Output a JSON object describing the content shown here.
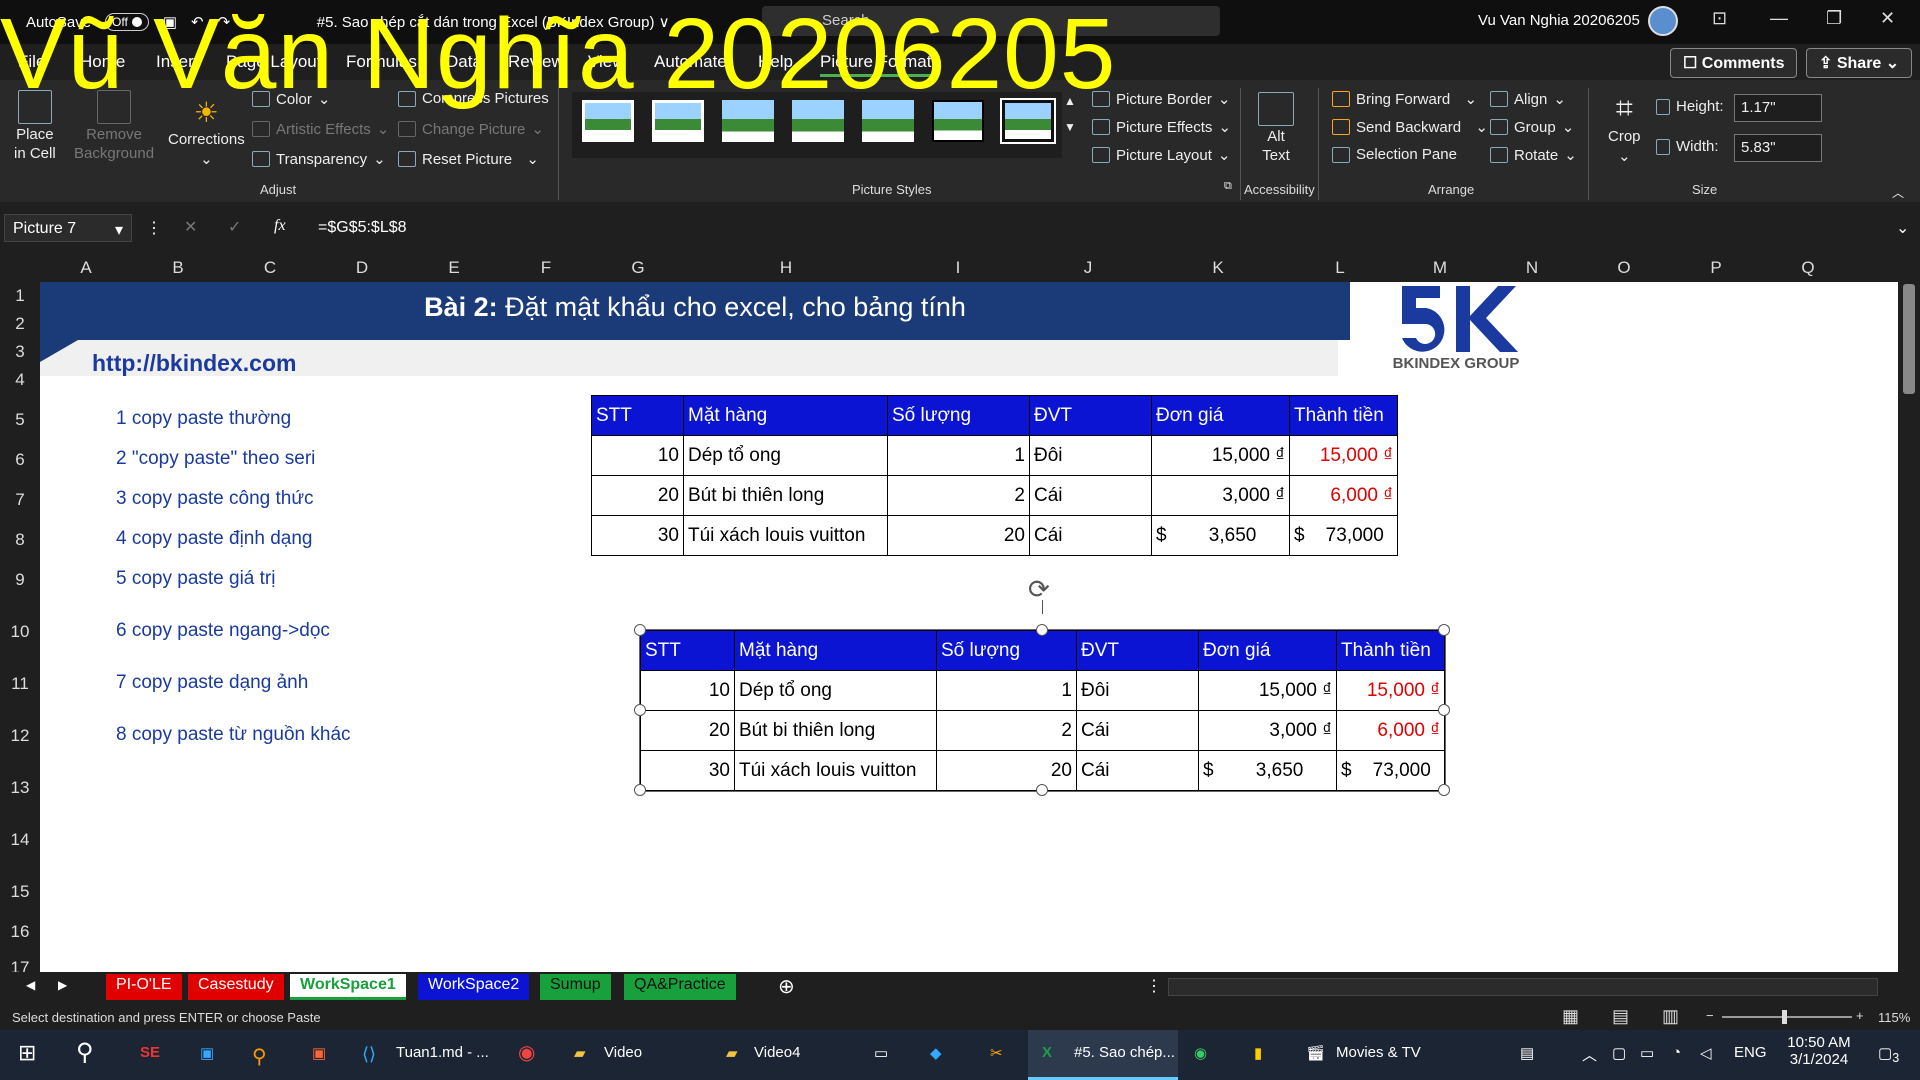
{
  "watermark": "Vũ Văn Nghĩa 20206205",
  "titlebar": {
    "autosave": "AutoSave",
    "autosave_state": "Off",
    "doc_title": "#5. Sao chép cắt dán trong Excel (BKIndex Group) ∨",
    "search": "Search",
    "user": "Vu Van Nghia 20206205"
  },
  "tabs": [
    "File",
    "Home",
    "Insert",
    "Page Layout",
    "Formulas",
    "Data",
    "Review",
    "View",
    "Automate",
    "Help",
    "Picture Format"
  ],
  "top_buttons": {
    "comments": "Comments",
    "share": "Share"
  },
  "ribbon": {
    "place_in_cell": [
      "Place",
      "in Cell"
    ],
    "remove_background": [
      "Remove",
      "Background"
    ],
    "corrections": "Corrections",
    "color": "Color",
    "artistic_effects": "Artistic Effects",
    "transparency": "Transparency",
    "compress_pictures": "Compress Pictures",
    "change_picture": "Change Picture",
    "reset_picture": "Reset Picture",
    "group_adjust": "Adjust",
    "group_styles": "Picture Styles",
    "picture_border": "Picture Border",
    "picture_effects": "Picture Effects",
    "picture_layout": "Picture Layout",
    "alt_text": [
      "Alt",
      "Text"
    ],
    "group_accessibility": "Accessibility",
    "bring_forward": "Bring Forward",
    "send_backward": "Send Backward",
    "selection_pane": "Selection Pane",
    "align": "Align",
    "group": "Group",
    "rotate": "Rotate",
    "group_arrange": "Arrange",
    "crop": "Crop",
    "height_label": "Height:",
    "height_value": "1.17\"",
    "width_label": "Width:",
    "width_value": "5.83\"",
    "group_size": "Size"
  },
  "formula_bar": {
    "name_box": "Picture 7",
    "formula": "=$G$5:$L$8"
  },
  "columns": [
    "A",
    "B",
    "C",
    "D",
    "E",
    "F",
    "G",
    "H",
    "I",
    "J",
    "K",
    "L",
    "M",
    "N",
    "O",
    "P",
    "Q"
  ],
  "rows": [
    "1",
    "2",
    "3",
    "4",
    "5",
    "6",
    "7",
    "8",
    "9",
    "10",
    "11",
    "12",
    "13",
    "14",
    "15",
    "16",
    "17"
  ],
  "banner": {
    "bold": "Bài 2:",
    "text": " Đặt mật khẩu cho excel, cho bảng tính"
  },
  "url": "http://bkindex.com",
  "logo_text": "BKINDEX GROUP",
  "list": [
    "1  copy paste thường",
    "2  \"copy paste\" theo seri",
    "3  copy paste công thức",
    "4  copy paste định dạng",
    "5  copy paste giá trị",
    "6  copy paste ngang->dọc",
    "7  copy paste dạng ảnh",
    "8  copy paste từ nguồn khác"
  ],
  "table": {
    "headers": [
      "STT",
      "Mặt hàng",
      "Số lượng",
      "ĐVT",
      "Đơn giá",
      "Thành tiền"
    ],
    "rows": [
      [
        "10",
        "Dép tổ ong",
        "1",
        "Đôi",
        "15,000 ₫",
        "15,000 ₫"
      ],
      [
        "20",
        "Bút bi thiên long",
        "2",
        "Cái",
        "3,000 ₫",
        "6,000 ₫"
      ],
      [
        "30",
        "Túi xách louis vuitton",
        "20",
        "Cái",
        "$        3,650",
        "$    73,000"
      ]
    ]
  },
  "sheet_tabs": [
    "PI-O'LE",
    "Casestudy",
    "WorkSpace1",
    "WorkSpace2",
    "Sumup",
    "QA&Practice"
  ],
  "sheet_tab_colors": [
    "#e00000",
    "#e00000",
    "#2b2b2b",
    "#0a14d2",
    "#18a03c",
    "#18a03c"
  ],
  "status": {
    "message": "Select destination and press ENTER or choose Paste",
    "zoom": "115%"
  },
  "taskbar": {
    "apps": [
      "Tuan1.md - ...",
      "Video",
      "Video4",
      "#5. Sao chép...",
      "Movies & TV"
    ],
    "lang": "ENG",
    "time": "10:50 AM",
    "date": "3/1/2024",
    "notif": "3"
  }
}
